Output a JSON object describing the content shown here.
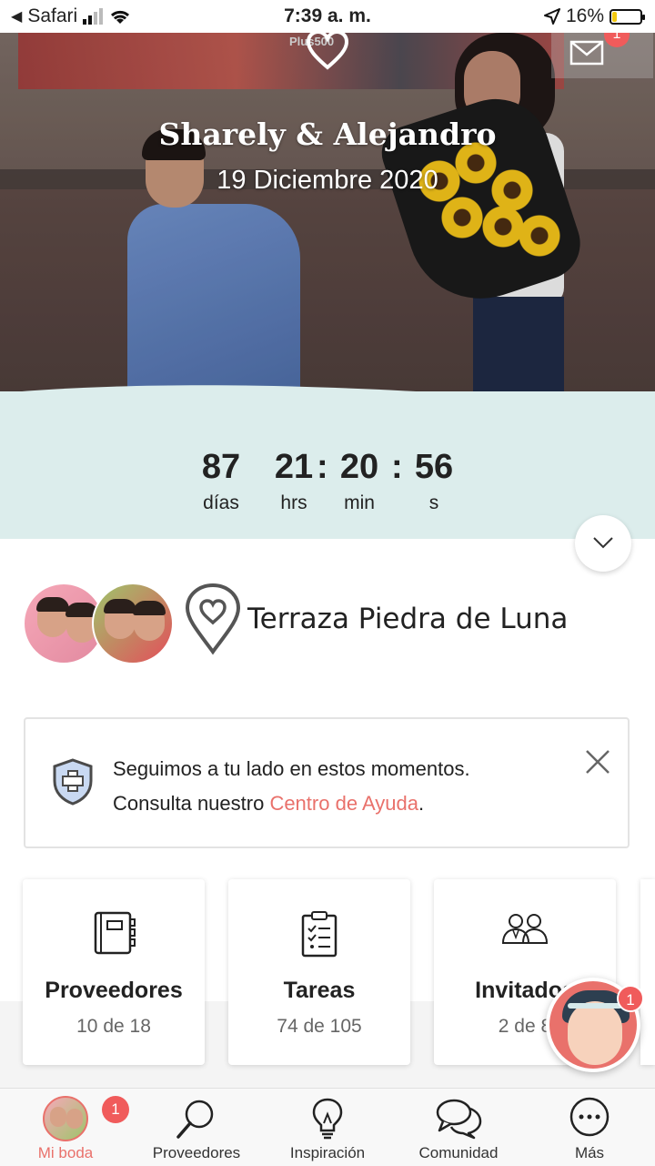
{
  "status_bar": {
    "back_app": "Safari",
    "time": "7:39 a. m.",
    "battery": "16%",
    "battery_level": 0.16
  },
  "hero": {
    "couple_names": "Sharely & Alejandro",
    "wedding_date": "19 Diciembre 2020",
    "poster_text": "Plus500",
    "messages_badge": "1"
  },
  "countdown": {
    "days": "87",
    "days_label": "días",
    "hours": "21",
    "hours_label": "hrs",
    "minutes": "20",
    "minutes_label": "min",
    "seconds": "56",
    "seconds_label": "s",
    "separator": ":"
  },
  "couple": {
    "venue": "Terraza Piedra de Luna"
  },
  "notice": {
    "line1": "Seguimos a tu lado en estos momentos.",
    "line2_prefix": "Consulta nuestro ",
    "link": "Centro de Ayuda",
    "line2_suffix": "."
  },
  "cards": [
    {
      "title": "Proveedores",
      "subtitle": "10 de 18",
      "icon": "notebook-icon"
    },
    {
      "title": "Tareas",
      "subtitle": "74 de 105",
      "icon": "checklist-icon"
    },
    {
      "title": "Invitados",
      "subtitle": "2 de 8",
      "icon": "guests-icon"
    }
  ],
  "assistant": {
    "badge": "1"
  },
  "tab_bar": {
    "items": [
      {
        "label": "Mi boda",
        "icon": "avatar",
        "badge": "1",
        "active": true
      },
      {
        "label": "Proveedores",
        "icon": "search-icon"
      },
      {
        "label": "Inspiración",
        "icon": "lightbulb-icon"
      },
      {
        "label": "Comunidad",
        "icon": "chat-bubbles-icon"
      },
      {
        "label": "Más",
        "icon": "more-icon"
      }
    ]
  },
  "colors": {
    "accent": "#e9716b",
    "countdown_band": "#dcedec",
    "badge": "#f05b5b"
  }
}
